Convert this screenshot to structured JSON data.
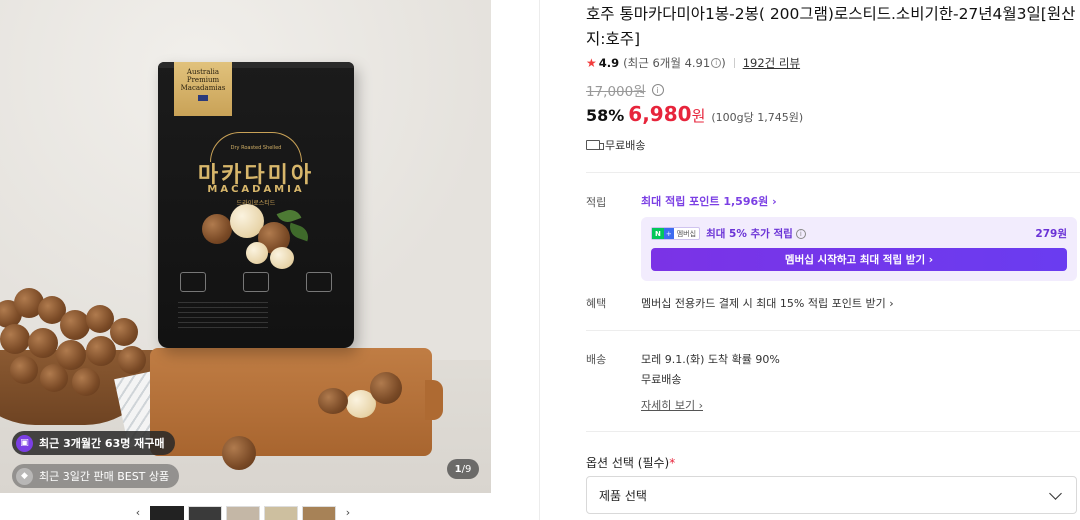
{
  "gallery": {
    "package": {
      "tag_line1": "Australia",
      "tag_line2": "Premium",
      "tag_line3": "Macadamias",
      "crest_text": "Dry Roasted Shelled",
      "name_kr": "마카다미아",
      "name_en": "MACADAMIA",
      "sub": "드라이로스티드"
    },
    "badge_repurchase": "최근 3개월간 63명 재구매",
    "badge_best": "최근 3일간 판매 BEST 상품",
    "pager_current": "1",
    "pager_total": "/9",
    "prev_arrow": "‹",
    "next_arrow": "›"
  },
  "product": {
    "title": "호주 통마카다미아1봉-2봉( 200그램)로스티드.소비기한-27년4월3일[원산지:호주]",
    "rating": "4.9",
    "rating_recent": "(최근 6개월 4.91",
    "rating_recent_close": ")",
    "review_count": "192건 리뷰",
    "original_price": "17,000원",
    "discount": "58%",
    "price": "6,980",
    "price_unit": "원",
    "unit_price": "(100g당 1,745원)",
    "shipping_badge": "무료배송"
  },
  "points": {
    "label": "적립",
    "max_points": "최대 적립 포인트 1,596원 ›",
    "nplus_n": "N",
    "nplus_plus": "+",
    "nplus_text": "멤버십",
    "extra_text": "최대 5% 추가 적립",
    "extra_value": "279원",
    "cta": "멤버십 시작하고 최대 적립 받기 ›"
  },
  "benefit": {
    "label": "혜택",
    "text": "멤버십 전용카드 결제 시 최대 15% 적립 포인트 받기 ›"
  },
  "delivery": {
    "label": "배송",
    "eta": "모레 9.1.(화) 도착 확률 90%",
    "fee": "무료배송",
    "more": "자세히 보기 ›"
  },
  "option": {
    "label": "옵션 선택 (필수)",
    "required_mark": "*",
    "select_value": "제품 선택"
  },
  "icons": {
    "star": "★",
    "info": "i"
  },
  "colors": {
    "price_red": "#e7243b",
    "membership_purple": "#7b3fe4"
  }
}
